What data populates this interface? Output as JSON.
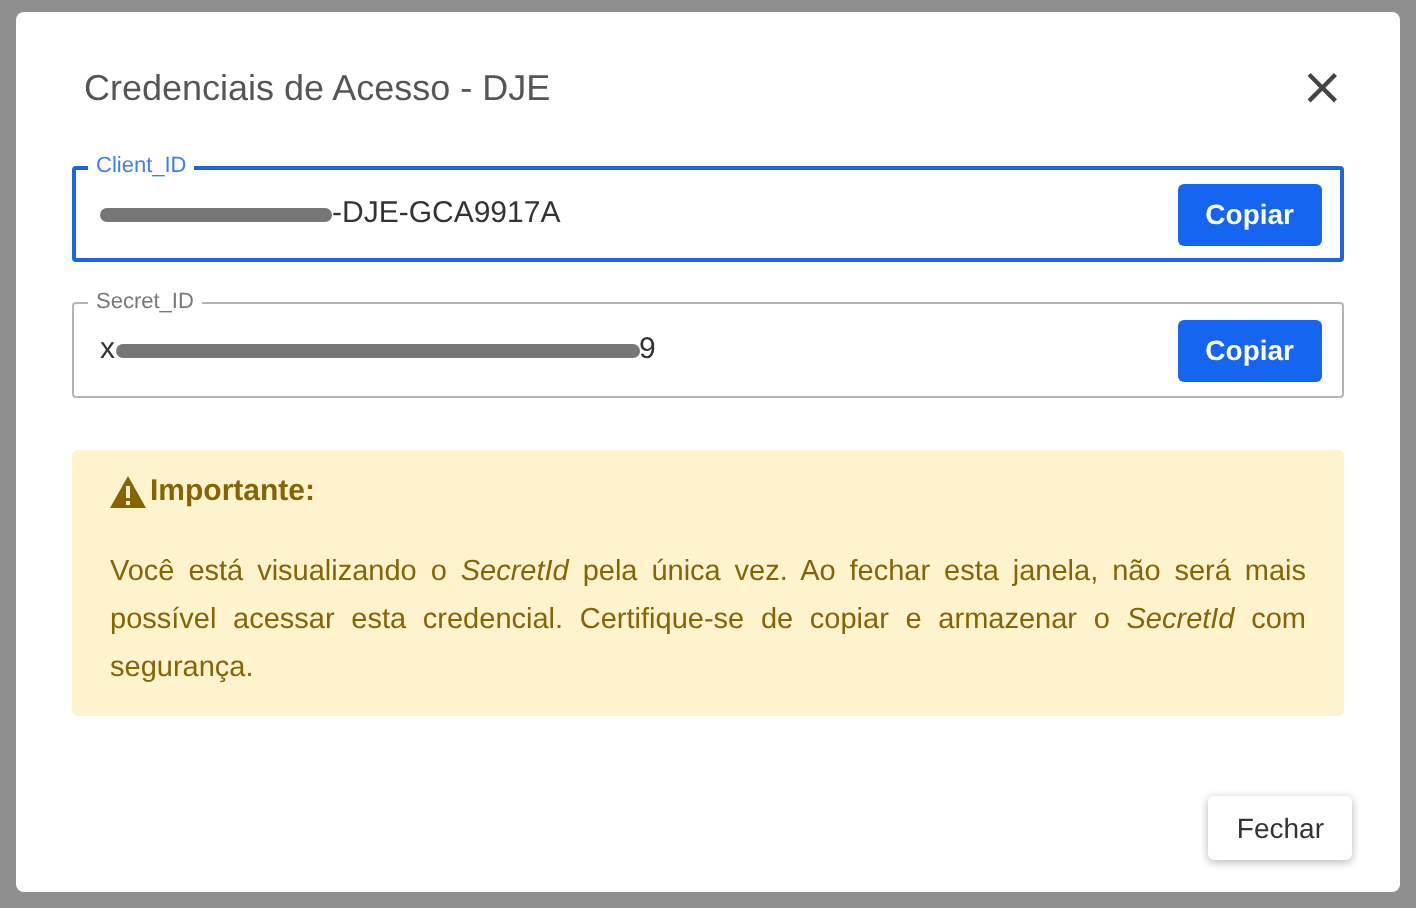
{
  "dialog": {
    "title": "Credenciais de Acesso - DJE",
    "close": "×"
  },
  "fields": [
    {
      "label": "Client_ID",
      "focused": true,
      "value": [
        {
          "kind": "redacted"
        },
        {
          "kind": "text",
          "text": "-DJE-GCA9917A"
        }
      ],
      "button": "Copiar"
    },
    {
      "label": "Secret_ID",
      "focused": false,
      "value": [
        {
          "kind": "text",
          "text": "x"
        },
        {
          "kind": "redacted"
        },
        {
          "kind": "text",
          "text": "9"
        }
      ],
      "button": "Copiar"
    }
  ],
  "alert": {
    "title": "Importante:",
    "message": "Você está visualizando o *SecretId* pela única vez. Ao fechar esta janela, não será mais possível acessar esta credencial. Certifique-se de copiar e armazenar o *SecretId* com segurança."
  },
  "buttons": [
    "Fechar"
  ]
}
